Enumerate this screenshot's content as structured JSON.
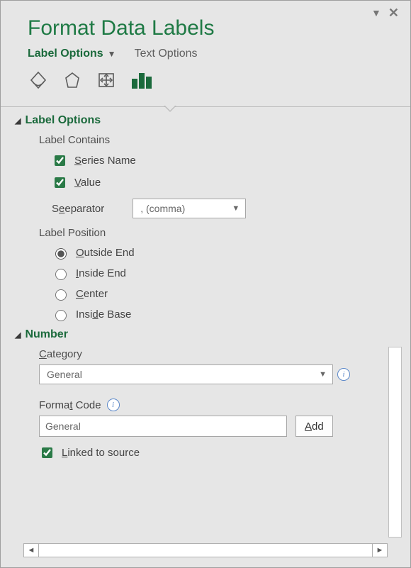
{
  "title": "Format Data Labels",
  "tabs": {
    "active": "Label Options",
    "inactive": "Text Options"
  },
  "section1": {
    "title": "Label Options",
    "contains_label": "Label Contains",
    "series_name": "eries Name",
    "value": "alue",
    "separator_label": "eparator",
    "separator_value": ", (comma)",
    "position_label": "Label Position",
    "pos_outside": "utside End",
    "pos_inside_end": "nside End",
    "pos_center": "enter",
    "pos_inside_base": "e Base"
  },
  "section2": {
    "title": "Number",
    "category_label": "ategory",
    "category_value": "General",
    "format_code_label": " Code",
    "format_code_value": "General",
    "add_btn": "dd",
    "linked": "inked to source"
  }
}
